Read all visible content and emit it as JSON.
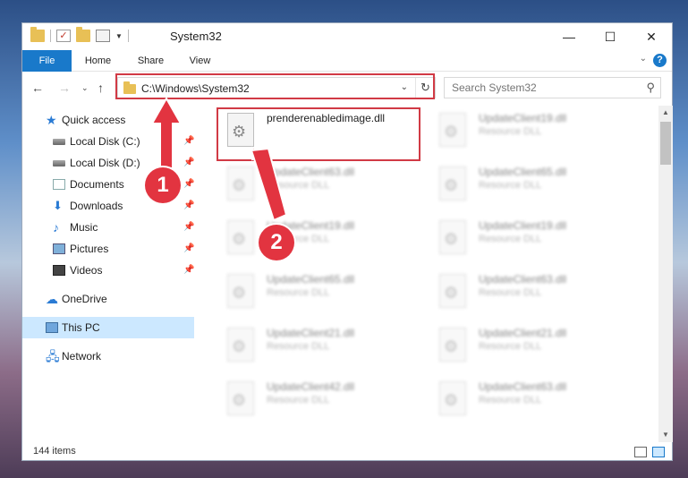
{
  "window": {
    "title": "System32",
    "quick_access_toolbar": [
      "folder-icon",
      "properties-icon",
      "new-folder-icon",
      "customize-icon"
    ],
    "controls": {
      "minimize": "—",
      "maximize": "☐",
      "close": "✕"
    }
  },
  "ribbon": {
    "tabs": [
      "File",
      "Home",
      "Share",
      "View"
    ],
    "active_tab_color": "#1979ca",
    "help": "?"
  },
  "navigation": {
    "address": "C:\\Windows\\System32",
    "search_placeholder": "Search System32"
  },
  "sidebar": {
    "items": [
      {
        "label": "Quick access",
        "icon": "star-icon"
      },
      {
        "label": "Local Disk (C:)",
        "icon": "disk-icon",
        "pinned": true
      },
      {
        "label": "Local Disk (D:)",
        "icon": "disk-icon",
        "pinned": true
      },
      {
        "label": "Documents",
        "icon": "documents-icon",
        "pinned": true
      },
      {
        "label": "Downloads",
        "icon": "download-icon",
        "pinned": true
      },
      {
        "label": "Music",
        "icon": "music-icon",
        "pinned": true
      },
      {
        "label": "Pictures",
        "icon": "pictures-icon",
        "pinned": true
      },
      {
        "label": "Videos",
        "icon": "videos-icon",
        "pinned": true
      },
      {
        "label": "OneDrive",
        "icon": "cloud-icon"
      },
      {
        "label": "This PC",
        "icon": "computer-icon",
        "selected": true
      },
      {
        "label": "Network",
        "icon": "network-icon"
      }
    ]
  },
  "files": [
    {
      "name": "prenderenabledimage.dll",
      "type": ""
    },
    {
      "name": "UpdateClient19.dll",
      "type": "Resource DLL"
    },
    {
      "name": "UpdateClient63.dll",
      "type": "Resource DLL"
    },
    {
      "name": "UpdateClient65.dll",
      "type": "Resource DLL"
    },
    {
      "name": "UpdateClient19.dll",
      "type": "Resource DLL"
    },
    {
      "name": "UpdateClient19.dll",
      "type": "Resource DLL"
    },
    {
      "name": "UpdateClient65.dll",
      "type": "Resource DLL"
    },
    {
      "name": "UpdateClient63.dll",
      "type": "Resource DLL"
    },
    {
      "name": "UpdateClient21.dll",
      "type": "Resource DLL"
    },
    {
      "name": "UpdateClient21.dll",
      "type": "Resource DLL"
    },
    {
      "name": "UpdateClient42.dll",
      "type": "Resource DLL"
    },
    {
      "name": "UpdateClient63.dll",
      "type": "Resource DLL"
    }
  ],
  "status": {
    "item_count": "144 items"
  },
  "annotations": {
    "step1": "1",
    "step2": "2",
    "color": "#e23440"
  }
}
